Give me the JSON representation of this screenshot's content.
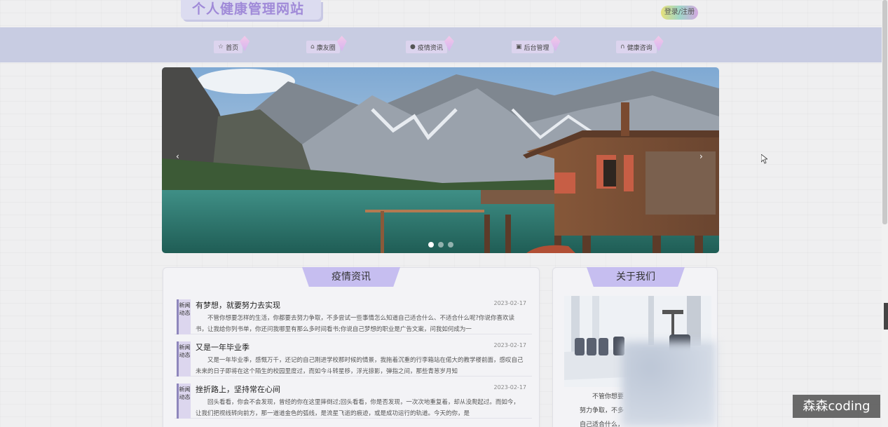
{
  "header": {
    "logo": "个人健康管理网站",
    "login": "登录/注册"
  },
  "nav": [
    {
      "label": "首页",
      "icon": "star-icon",
      "glyph": "☆"
    },
    {
      "label": "康友圈",
      "icon": "home-icon",
      "glyph": "⌂"
    },
    {
      "label": "疫情资讯",
      "icon": "info-icon",
      "glyph": "●"
    },
    {
      "label": "后台管理",
      "icon": "briefcase-icon",
      "glyph": "▣"
    },
    {
      "label": "健康咨询",
      "icon": "headset-icon",
      "glyph": "∩"
    }
  ],
  "banner": {
    "prev": "‹",
    "next": "›",
    "slide_count": 3,
    "active_slide": 1
  },
  "news_panel": {
    "title": "疫情资讯",
    "items": [
      {
        "tag": "新闻动态",
        "title": "有梦想，就要努力去实现",
        "date": "2023-02-17",
        "body": "不管你想要怎样的生活，你都要去努力争取，不多尝试一些事情怎么知道自己适合什么、不适合什么呢?你说你喜欢读书，让我给你列书单，你还问我哪里有那么多时间看书;你说自己梦想的职业是广告文案，问我如何成为一"
      },
      {
        "tag": "新闻动态",
        "title": "又是一年毕业季",
        "date": "2023-02-17",
        "body": "又是一年毕业季，感慨万千，还记的自己刚进学校那时候的情景，我拖着沉重的行李箱站在偌大的教学楼前面，感叹自己未来的日子即将在这个陌生的校园里度过，而如今斗转星移，浮光掠影，弹指之间，那些青葱岁月知"
      },
      {
        "tag": "新闻动态",
        "title": "挫折路上，坚持常在心间",
        "date": "2023-02-17",
        "body": "回头看看，你会不会发现，曾经的你在这里摔倒过;回头看看，你是否发现，一次次地重复着，却从没爬起过。而如今，让我们把视线转向前方，那一道道金色的弧线，是流星飞逝的痕迹，或是成功运行的轨道。今天的你，是"
      }
    ]
  },
  "about_panel": {
    "title": "关于我们",
    "lines": [
      "不管你想要",
      "努力争取，不多",
      "自己适合什么，"
    ]
  },
  "watermark": "森森coding",
  "colors": {
    "nav_bg": "#c8cce2",
    "accent": "#c6bef0",
    "logo_text": "#a08ad8"
  }
}
